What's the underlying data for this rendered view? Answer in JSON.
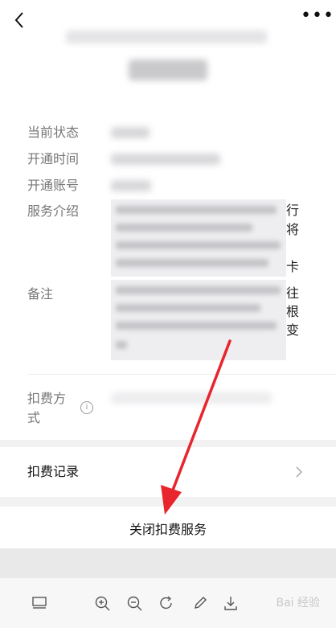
{
  "header": {
    "back_icon": "chevron-left-icon",
    "more_icon": "more-dots-icon",
    "more_label": "•••"
  },
  "info": {
    "status_label": "当前状态",
    "open_time_label": "开通时间",
    "account_label": "开通账号",
    "service_intro_label": "服务介绍",
    "notes_label": "备注",
    "payment_method_label": "扣费方式",
    "intro_side_chars": [
      "行",
      "将",
      "卡"
    ],
    "notes_side_chars": [
      "往",
      "根",
      "变"
    ],
    "info_icon": "info-circle-icon",
    "info_glyph": "i"
  },
  "records": {
    "label": "扣费记录",
    "chevron_icon": "chevron-right-icon"
  },
  "close_service": {
    "label": "关闭扣费服务"
  },
  "toolbar": {
    "icons": [
      "layout-icon",
      "zoom-in-icon",
      "zoom-out-icon",
      "rotate-icon",
      "pen-icon",
      "download-icon"
    ],
    "watermark": "Bai 经验"
  },
  "annotation": {
    "arrow_color": "#e8242c"
  }
}
